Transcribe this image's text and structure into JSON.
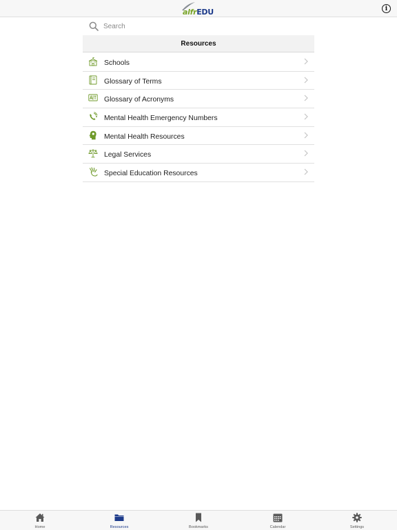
{
  "header": {
    "logo_alfr": "alfr",
    "logo_edu": "EDU",
    "info_glyph": "i",
    "logo_colors": {
      "alfr": "#7aa52a",
      "edu": "#1c3a8a"
    }
  },
  "search": {
    "placeholder": "Search",
    "value": ""
  },
  "section": {
    "title": "Resources"
  },
  "list": {
    "icon_color": "#6f9a2a",
    "items": [
      {
        "label": "Schools",
        "icon": "school-icon"
      },
      {
        "label": "Glossary of Terms",
        "icon": "book-icon"
      },
      {
        "label": "Glossary of Acronyms",
        "icon": "acronym-icon"
      },
      {
        "label": "Mental Health Emergency Numbers",
        "icon": "phone-emergency-icon"
      },
      {
        "label": "Mental Health Resources",
        "icon": "head-icon"
      },
      {
        "label": "Legal Services",
        "icon": "scales-icon"
      },
      {
        "label": "Special Education Resources",
        "icon": "hand-icon"
      }
    ]
  },
  "tabs": {
    "active_color": "#1c3a8a",
    "inactive_color": "#5a5a5a",
    "items": [
      {
        "label": "Home",
        "icon": "home-icon",
        "active": false
      },
      {
        "label": "Resources",
        "icon": "folder-icon",
        "active": true
      },
      {
        "label": "Bookmarks",
        "icon": "bookmark-icon",
        "active": false
      },
      {
        "label": "Calendar",
        "icon": "calendar-icon",
        "active": false
      },
      {
        "label": "Settings",
        "icon": "gear-icon",
        "active": false
      }
    ]
  }
}
